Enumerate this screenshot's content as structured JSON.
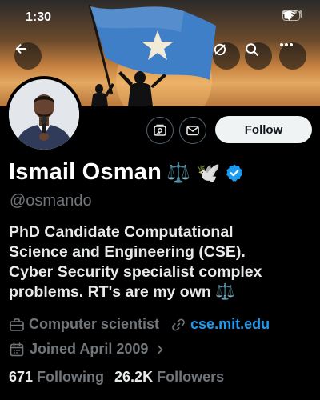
{
  "status_bar": {
    "time": "1:30"
  },
  "profile": {
    "display_name": "Ismail Osman",
    "name_emojis": "⚖️ 🕊️",
    "handle": "@osmando",
    "bio_lines": [
      "PhD Candidate Computational",
      "Science and Engineering (CSE).",
      "Cyber Security specialist complex",
      "problems. RT's are my own ⚖️"
    ],
    "profession": "Computer scientist",
    "website": "cse.mit.edu",
    "joined": "Joined April 2009",
    "following_count": "671",
    "following_label": "Following",
    "followers_count": "26.2K",
    "followers_label": "Followers",
    "follow_button": "Follow"
  },
  "icons": {
    "back": "back-arrow-icon",
    "grok": "grok-icon",
    "search": "search-icon",
    "more": "more-icon",
    "media": "media-icon",
    "message": "message-icon",
    "verified": "verified-badge-icon",
    "briefcase": "briefcase-icon",
    "link": "link-icon",
    "calendar": "calendar-icon",
    "chevron": "chevron-right-icon"
  },
  "colors": {
    "accent": "#1d9bf0",
    "verified": "#1d9bf0",
    "muted_text": "#71767b",
    "flag_blue": "#4189dd",
    "follow_bg": "#eff3f4"
  }
}
